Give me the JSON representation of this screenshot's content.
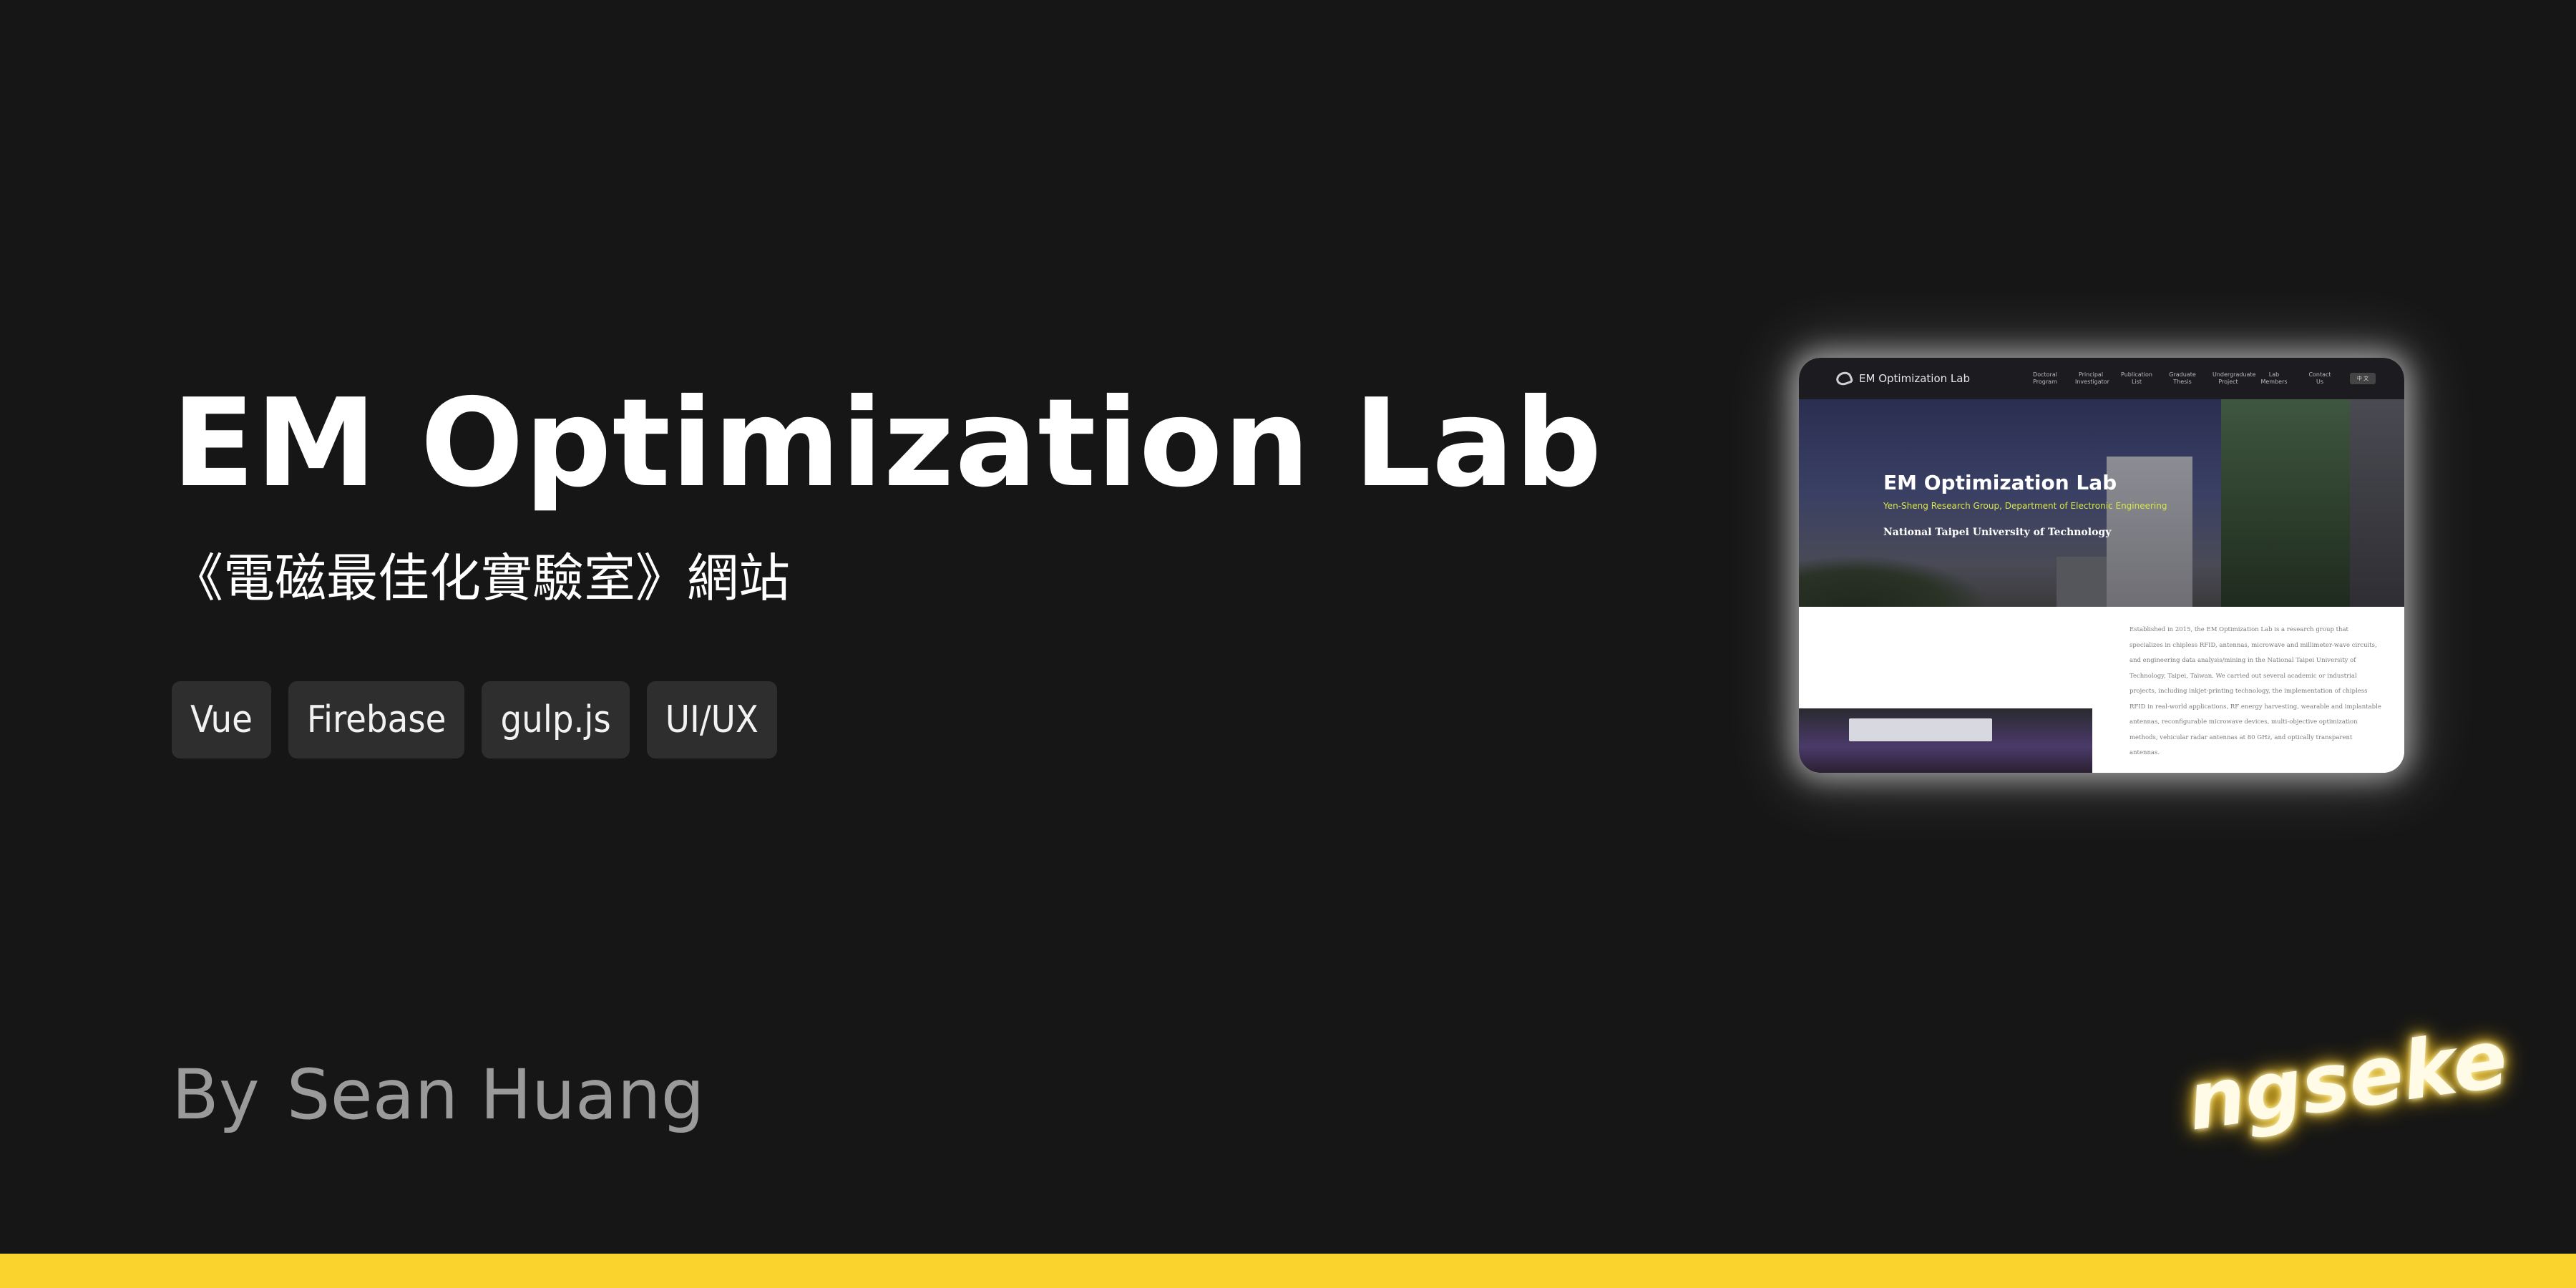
{
  "hero": {
    "title": "EM Optimization Lab",
    "subtitle": "《電磁最佳化實驗室》網站",
    "tags": [
      "Vue",
      "Firebase",
      "gulp.js",
      "UI/UX"
    ]
  },
  "byline": {
    "prefix": "By",
    "author": "Sean Huang"
  },
  "signature": "ngseke",
  "preview": {
    "nav_logo": "EM Optimization Lab",
    "nav_items": [
      [
        "Doctoral",
        "Program"
      ],
      [
        "Principal",
        "Investigator"
      ],
      [
        "Publication",
        "List"
      ],
      [
        "Graduate",
        "Thesis"
      ],
      [
        "Undergraduate",
        "Project"
      ],
      [
        "Lab",
        "Members"
      ],
      [
        "Contact",
        "Us"
      ]
    ],
    "nav_lang": "中 文",
    "hero_title": "EM Optimization Lab",
    "hero_subtitle": "Yen-Sheng Research Group, Department of Electronic Engineering",
    "hero_university": "National Taipei University of Technology",
    "body_text": "Established in 2015, the EM Optimization Lab is a research group that specializes in chipless RFID, antennas, microwave and millimeter-wave circuits, and engineering data analysis/mining in the National Taipei University of Technology, Taipei, Taiwan. We carried out several academic or industrial projects, including inkjet-printing technology, the implementation of chipless RFID in real-world applications, RF energy harvesting, wearable and implantable antennas, reconfigurable microwave devices, multi-objective optimization methods, vehicular radar antennas at 80 GHz, and optically transparent antennas."
  },
  "colors": {
    "background": "#161616",
    "tag_background": "#2e2e2e",
    "byline": "#9a9a9a",
    "accent_bar": "#fbd32d",
    "neon_glow": "#ffd84a",
    "preview_subtitle": "#d9e64a"
  }
}
